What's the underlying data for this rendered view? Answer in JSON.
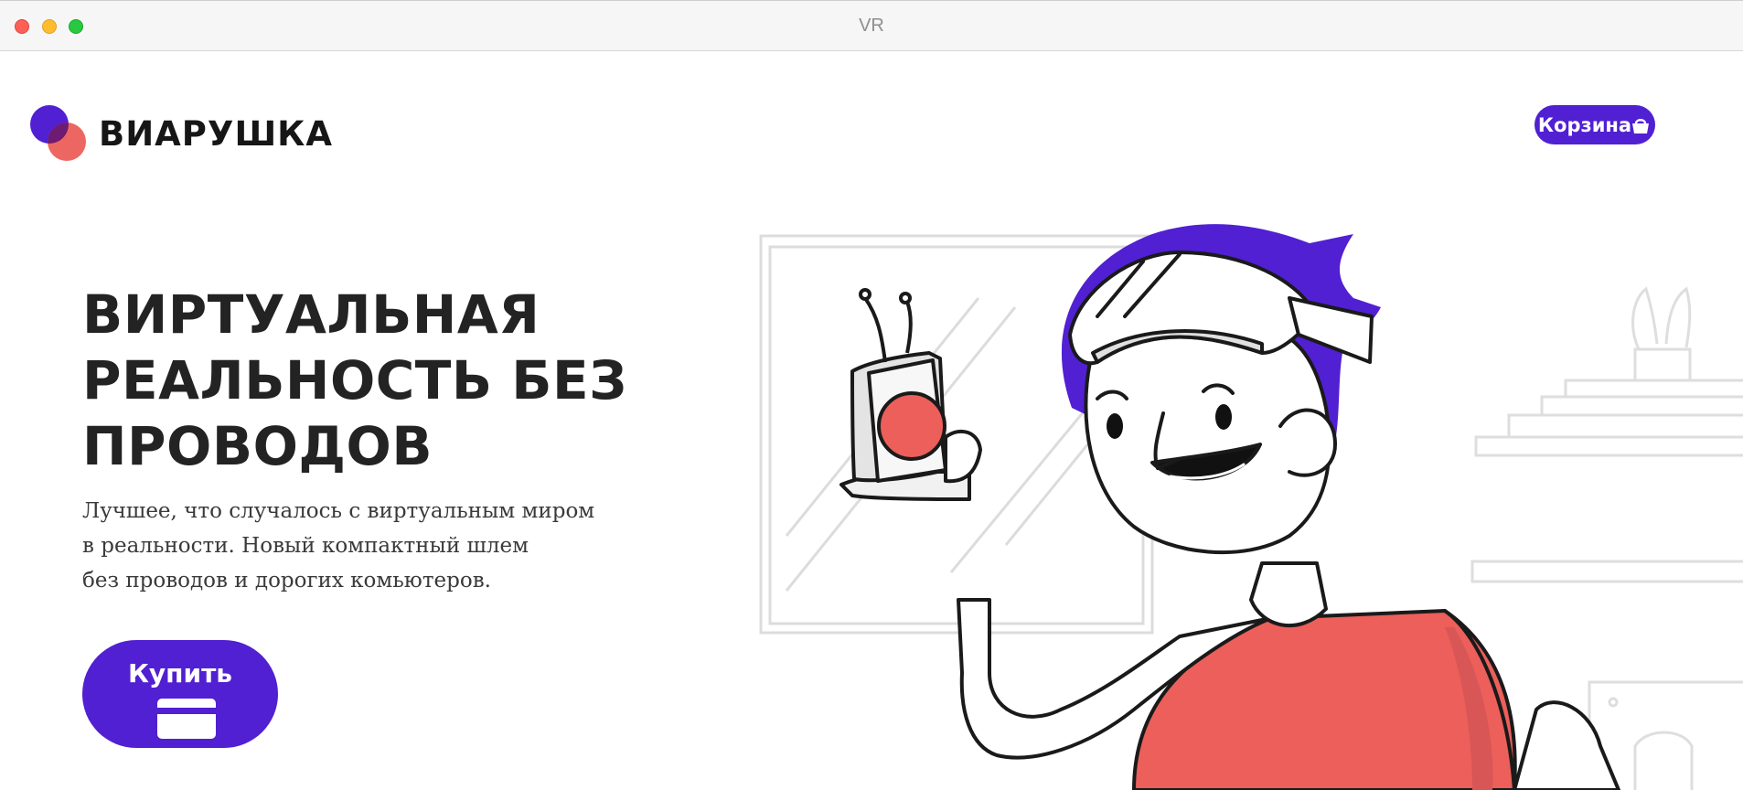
{
  "window": {
    "title": "VR"
  },
  "brand": {
    "name": "ВИАРУШКА",
    "colors": {
      "primary": "#5120d2",
      "secondary": "#ec5f5a",
      "text": "#232323"
    }
  },
  "header": {
    "cart_label": "Корзина",
    "cart_icon": "basket-icon"
  },
  "hero": {
    "title_lines": [
      "ВИРТУАЛЬНАЯ",
      "РЕАЛЬНОСТЬ БЕЗ",
      "ПРОВОДОВ"
    ],
    "description_lines": [
      "Лучшее, что случалось с виртуальным миром",
      "в реальности. Новый компактный шлем",
      "без проводов и дорогих комьютеров."
    ],
    "buy_label": "Купить",
    "buy_icon": "credit-card-icon"
  },
  "illustration": {
    "subject": "person-with-vr-headset-holding-device",
    "icon": "vr-user-illustration"
  }
}
